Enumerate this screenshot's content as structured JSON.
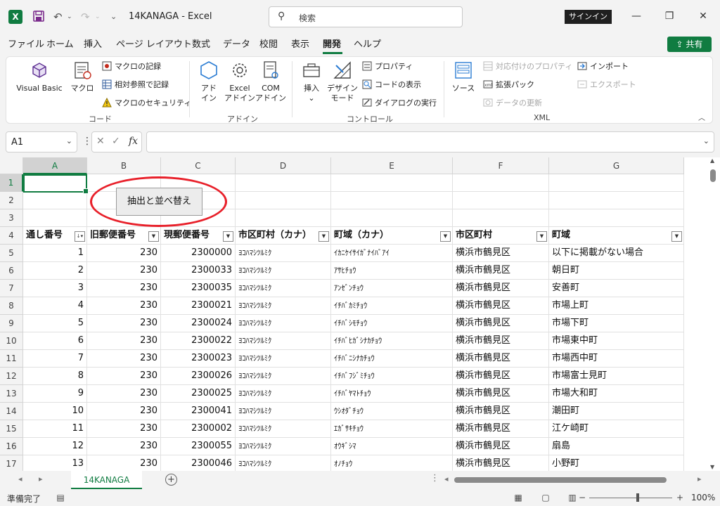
{
  "titlebar": {
    "app_icon": "X",
    "save_icon": "save-icon",
    "undo_icon": "undo-icon",
    "redo_icon": "redo-icon",
    "title": "14KANAGA  -  Excel",
    "search_placeholder": "検索",
    "signin_label": "サインイン",
    "minimize": "—",
    "restore": "❐",
    "close": "✕"
  },
  "menu": {
    "items": [
      "ファイル",
      "ホーム",
      "挿入",
      "ページ レイアウト",
      "数式",
      "データ",
      "校閲",
      "表示",
      "開発",
      "ヘルプ"
    ],
    "active": "開発",
    "share_label": "共有"
  },
  "ribbon": {
    "code": {
      "label": "コード",
      "visual_basic": "Visual Basic",
      "macro": "マクロ",
      "record_macro": "マクロの記録",
      "relative_ref": "相対参照で記録",
      "macro_security": "マクロのセキュリティ"
    },
    "addins": {
      "label": "アドイン",
      "addin_line1": "アド",
      "addin_line2": "イン",
      "excel_line1": "Excel",
      "excel_line2": "アドイン",
      "com_line1": "COM",
      "com_line2": "アドイン"
    },
    "controls": {
      "label": "コントロール",
      "insert": "挿入",
      "design_line1": "デザイン",
      "design_line2": "モード",
      "properties": "プロパティ",
      "view_code": "コードの表示",
      "run_dialog": "ダイアログの実行"
    },
    "xml": {
      "label": "XML",
      "source": "ソース",
      "map_props": "対応付けのプロパティ",
      "expansion_pack": "拡張パック",
      "refresh": "データの更新",
      "import": "インポート",
      "export": "エクスポート"
    }
  },
  "formula_bar": {
    "name_box": "A1",
    "cancel": "✕",
    "enter": "✓",
    "fx": "fx",
    "value": ""
  },
  "sheet": {
    "columns": [
      "A",
      "B",
      "C",
      "D",
      "E",
      "F",
      "G"
    ],
    "row_numbers": [
      "1",
      "2",
      "3",
      "4",
      "5",
      "6",
      "7",
      "8",
      "9",
      "10",
      "11",
      "12",
      "13",
      "14",
      "15",
      "16",
      "17"
    ],
    "macro_button": "抽出と並べ替え",
    "headers": [
      "通し番号",
      "旧郵便番号",
      "現郵便番号",
      "市区町村（カナ）",
      "町域（カナ）",
      "市区町村",
      "町域"
    ],
    "rows": [
      [
        "1",
        "230",
        "2300000",
        "ﾖｺﾊﾏｼﾂﾙﾐｸ",
        "ｲｶﾆｹｲｻｲｶﾞﾅｲﾊﾞｱｲ",
        "横浜市鶴見区",
        "以下に掲載がない場合"
      ],
      [
        "2",
        "230",
        "2300033",
        "ﾖｺﾊﾏｼﾂﾙﾐｸ",
        "ｱｻﾋﾁｮｳ",
        "横浜市鶴見区",
        "朝日町"
      ],
      [
        "3",
        "230",
        "2300035",
        "ﾖｺﾊﾏｼﾂﾙﾐｸ",
        "ｱﾝｾﾞﾝﾁｮｳ",
        "横浜市鶴見区",
        "安善町"
      ],
      [
        "4",
        "230",
        "2300021",
        "ﾖｺﾊﾏｼﾂﾙﾐｸ",
        "ｲﾁﾊﾞｶﾐﾁｮｳ",
        "横浜市鶴見区",
        "市場上町"
      ],
      [
        "5",
        "230",
        "2300024",
        "ﾖｺﾊﾏｼﾂﾙﾐｸ",
        "ｲﾁﾊﾞｼﾓﾁｮｳ",
        "横浜市鶴見区",
        "市場下町"
      ],
      [
        "6",
        "230",
        "2300022",
        "ﾖｺﾊﾏｼﾂﾙﾐｸ",
        "ｲﾁﾊﾞﾋｶﾞｼﾅｶﾁｮｳ",
        "横浜市鶴見区",
        "市場東中町"
      ],
      [
        "7",
        "230",
        "2300023",
        "ﾖｺﾊﾏｼﾂﾙﾐｸ",
        "ｲﾁﾊﾞﾆｼﾅｶﾁｮｳ",
        "横浜市鶴見区",
        "市場西中町"
      ],
      [
        "8",
        "230",
        "2300026",
        "ﾖｺﾊﾏｼﾂﾙﾐｸ",
        "ｲﾁﾊﾞﾌｼﾞﾐﾁｮｳ",
        "横浜市鶴見区",
        "市場富士見町"
      ],
      [
        "9",
        "230",
        "2300025",
        "ﾖｺﾊﾏｼﾂﾙﾐｸ",
        "ｲﾁﾊﾞﾔﾏﾄﾁｮｳ",
        "横浜市鶴見区",
        "市場大和町"
      ],
      [
        "10",
        "230",
        "2300041",
        "ﾖｺﾊﾏｼﾂﾙﾐｸ",
        "ｳｼｵﾀﾞﾁｮｳ",
        "横浜市鶴見区",
        "潮田町"
      ],
      [
        "11",
        "230",
        "2300002",
        "ﾖｺﾊﾏｼﾂﾙﾐｸ",
        "ｴｶﾞｻｷﾁｮｳ",
        "横浜市鶴見区",
        "江ケ崎町"
      ],
      [
        "12",
        "230",
        "2300055",
        "ﾖｺﾊﾏｼﾂﾙﾐｸ",
        "ｵｳｷﾞｼﾏ",
        "横浜市鶴見区",
        "扇島"
      ],
      [
        "13",
        "230",
        "2300046",
        "ﾖｺﾊﾏｼﾂﾙﾐｸ",
        "ｵﾉﾁｮｳ",
        "横浜市鶴見区",
        "小野町"
      ]
    ]
  },
  "tabs": {
    "sheet_name": "14KANAGA",
    "add": "+"
  },
  "status": {
    "ready": "準備完了",
    "zoom": "100%",
    "zoom_out": "−",
    "zoom_in": "+"
  },
  "colors": {
    "accent": "#107c41",
    "annotation": "#e8202a"
  }
}
